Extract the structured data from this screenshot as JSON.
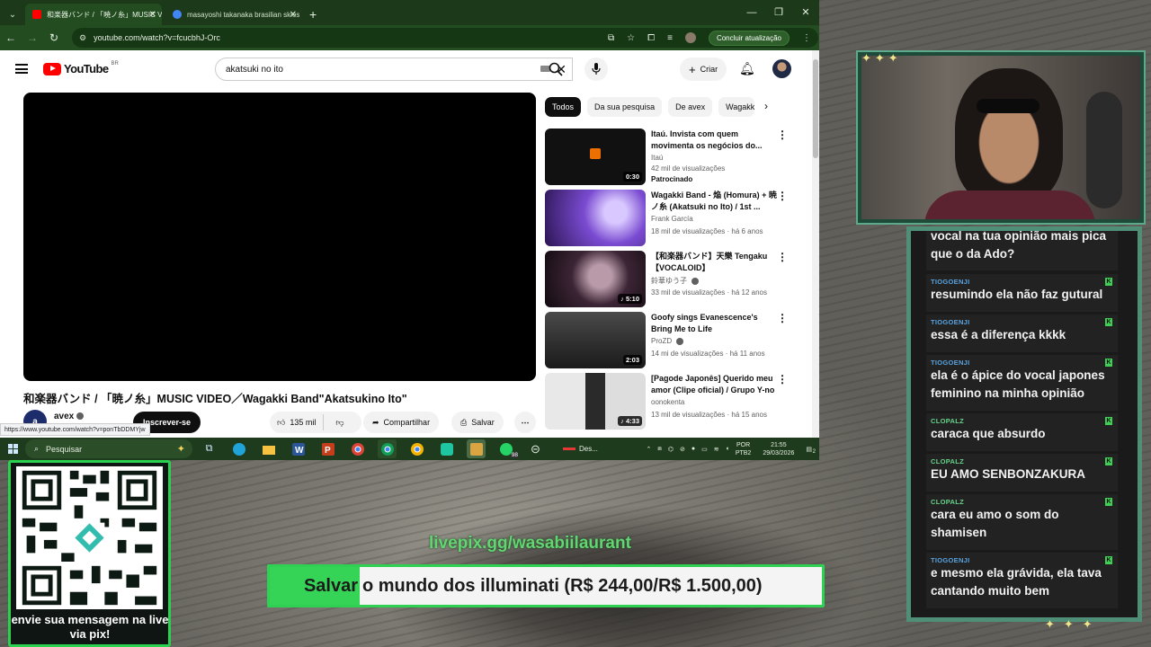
{
  "browser": {
    "tabs": [
      {
        "title": "和楽器バンド / 「暁ノ糸」MUSIC VIDEO",
        "active": true
      },
      {
        "title": "masayoshi takanaka brasilian skies",
        "active": false
      }
    ],
    "url": "youtube.com/watch?v=fcucbhJ-Orc",
    "update_label": "Concluir atualização",
    "status_url": "https://www.youtube.com/watch?v=ponTbDDMYjw"
  },
  "youtube": {
    "logo_text": "YouTube",
    "logo_region": "BR",
    "search_value": "akatsuki no ito",
    "create_label": "Criar",
    "video_title": "和楽器バンド / 「暁ノ糸」MUSIC VIDEO／Wagakki Band\"Akatsukino Ito\"",
    "channel_name": "avex",
    "channel_initial": "a",
    "subscribe_label": "Inscrever-se",
    "likes": "135 mil",
    "share_label": "Compartilhar",
    "save_label": "Salvar",
    "chips": [
      "Todos",
      "Da sua pesquisa",
      "De avex",
      "Wagakki"
    ],
    "recommendations": [
      {
        "title": "Itaú. Invista com quem movimenta os negócios do...",
        "line2": "Itaú",
        "line3": "42 mil de visualizações",
        "line4": "Patrocinado",
        "duration": "0:30",
        "color": "#1a1a1a"
      },
      {
        "title": "Wagakki Band - 焔 (Homura) + 暁ノ糸 (Akatsuki no Ito) / 1st ...",
        "line2": "Frank García",
        "line3": "18 mil de visualizações · há 6 anos",
        "duration": "",
        "color": "#6b3fa8"
      },
      {
        "title": "【和楽器バンド】天樂 Tengaku【VOCALOID】",
        "line2": "鈴華ゆう子",
        "line3": "33 mil de visualizações · há 12 anos",
        "duration": "5:10",
        "color": "#2a1e2a"
      },
      {
        "title": "Goofy sings Evanescence's Bring Me to Life",
        "line2": "ProZD",
        "line3": "14 mi de visualizações · há 11 anos",
        "duration": "2:03",
        "color": "#3a3a3a"
      },
      {
        "title": "[Pagode Japonês] Querido meu amor (Clipe oficial) / Grupo Y-no",
        "line2": "oonokenta",
        "line3": "13 mil de visualizações · há 15 anos",
        "duration": "4:33",
        "color": "#d9d9d9"
      }
    ]
  },
  "taskbar": {
    "search_placeholder": "Pesquisar",
    "badge": "98",
    "app_label": "Des...",
    "lang1": "POR",
    "lang2": "PTB2",
    "time": "21:55",
    "date": "29/03/2026",
    "notif": "2"
  },
  "stream": {
    "qr_caption": "envie sua mensagem na live via pix!",
    "livepix_url": "livepix.gg/wasabiilaurant",
    "goal_prefix": "Salvar",
    "goal_text": "o mundo dos illuminati (R$ 244,00/R$ 1.500,00)",
    "goal_progress": 0.163,
    "chat": [
      {
        "user": "",
        "text": "vocal na tua opinião mais pica que o da Ado?"
      },
      {
        "user": "TIOGOENJI",
        "text": "resumindo ela não faz gutural"
      },
      {
        "user": "TIOGOENJI",
        "text": "essa é a diferença kkkk"
      },
      {
        "user": "TIOGOENJI",
        "text": "ela é o ápice do vocal japones feminino na minha opinião"
      },
      {
        "user": "CLOPALZ",
        "text": "caraca que absurdo"
      },
      {
        "user": "CLOPALZ",
        "text": "EU AMO SENBONZAKURA"
      },
      {
        "user": "CLOPALZ",
        "text": "cara eu amo o som do shamisen"
      },
      {
        "user": "TIOGOENJI",
        "text": "e mesmo ela grávida, ela tava cantando muito bem"
      }
    ]
  }
}
